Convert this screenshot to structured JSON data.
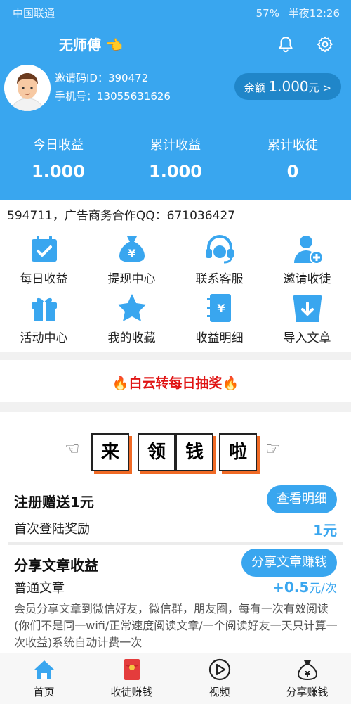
{
  "status": {
    "carrier": "中国联通",
    "battery": "57%",
    "time": "半夜12:26"
  },
  "header": {
    "username": "无师傅",
    "emoji": "👈",
    "invite": "邀请码ID：390472",
    "phone": "手机号：13055631626",
    "balance_label": "余额",
    "balance_value": "1.000",
    "balance_unit": "元 >",
    "stats": [
      {
        "label": "今日收益",
        "value": "1.000"
      },
      {
        "label": "累计收益",
        "value": "1.000"
      },
      {
        "label": "累计收徒",
        "value": "0"
      }
    ]
  },
  "marquee": "594711，广告商务合作QQ：671036427",
  "grid": [
    {
      "label": "每日收益",
      "icon": "calendar-check-icon"
    },
    {
      "label": "提现中心",
      "icon": "money-bag-icon"
    },
    {
      "label": "联系客服",
      "icon": "headset-icon"
    },
    {
      "label": "邀请收徒",
      "icon": "add-user-icon"
    },
    {
      "label": "活动中心",
      "icon": "gift-icon"
    },
    {
      "label": "我的收藏",
      "icon": "star-icon"
    },
    {
      "label": "收益明细",
      "icon": "notebook-yen-icon"
    },
    {
      "label": "导入文章",
      "icon": "download-tray-icon"
    }
  ],
  "lottery": {
    "text": "白云转每日抽奖",
    "icon": "fire-icon"
  },
  "banner": {
    "chars": [
      "来",
      "领",
      "钱",
      "啦"
    ]
  },
  "register": {
    "title": "注册赠送1元",
    "button": "查看明细",
    "sub": "首次登陆奖励",
    "reward": "1元"
  },
  "share": {
    "title": "分享文章收益",
    "button": "分享文章赚钱",
    "sub": "普通文章",
    "reward_amount": "+0.5",
    "reward_unit": "元/次",
    "desc": "会员分享文章到微信好友，微信群，朋友圈，每有一次有效阅读(你们不是同一wifi/正常速度阅读文章/一个阅读好友一天只计算一次收益)系统自动计费一次"
  },
  "tabs": [
    {
      "label": "首页",
      "icon": "home-icon"
    },
    {
      "label": "收徒赚钱",
      "icon": "red-envelope-icon"
    },
    {
      "label": "视频",
      "icon": "play-icon"
    },
    {
      "label": "分享赚钱",
      "icon": "money-bag-icon"
    }
  ],
  "colors": {
    "primary": "#39a6ef",
    "balance_bg": "#2086c9",
    "accent_red": "#e01414",
    "accent_orange": "#f06a25"
  }
}
